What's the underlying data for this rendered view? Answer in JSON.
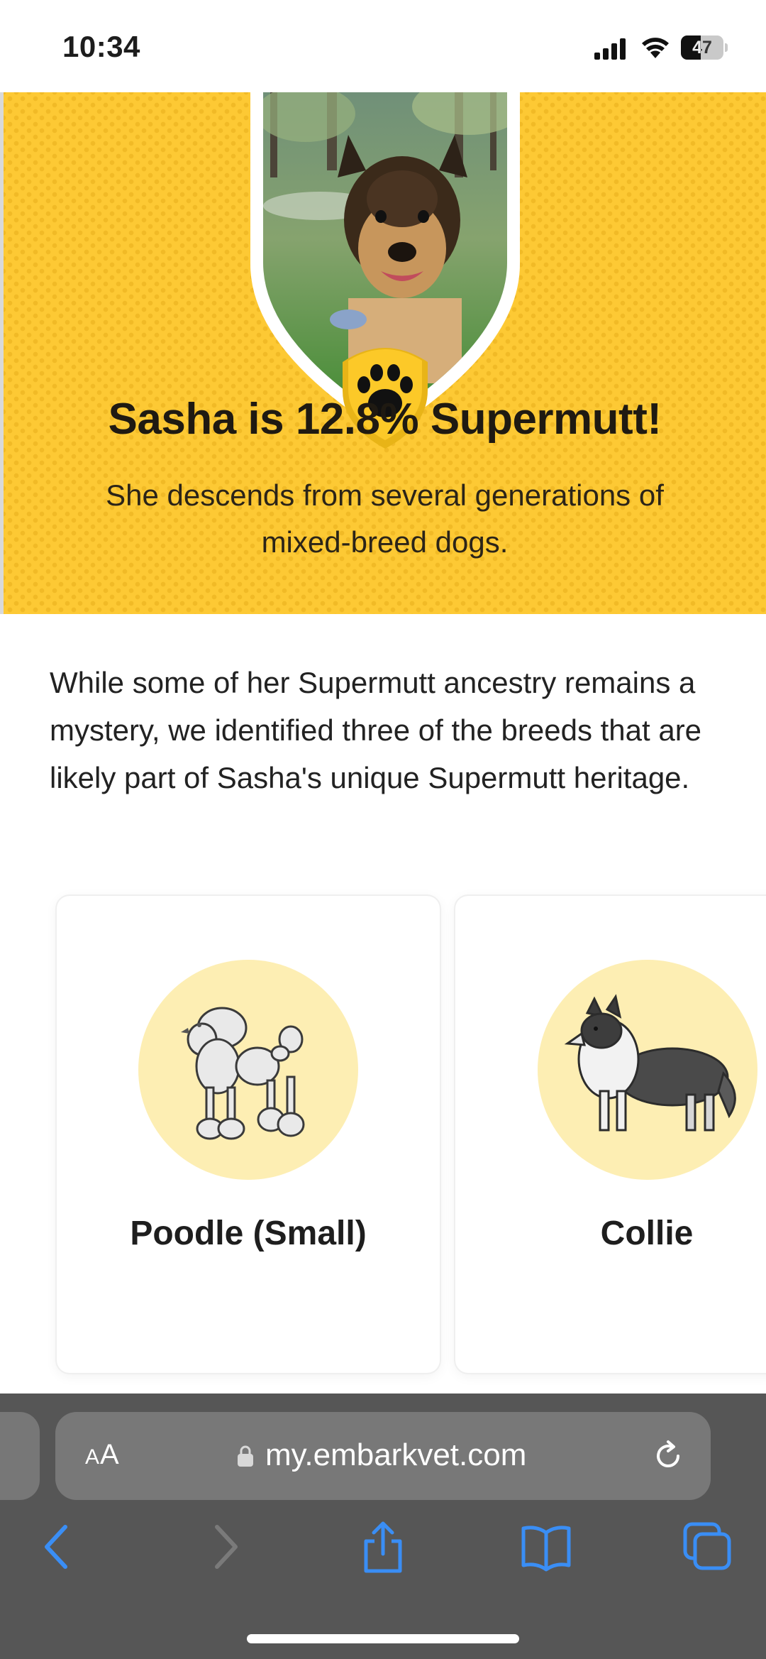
{
  "status_bar": {
    "time": "10:34",
    "battery": "47",
    "battery_level": 0.47
  },
  "hero": {
    "title": "Sasha is 12.8% Supermutt!",
    "subtitle": "She descends from several generations of mixed-breed dogs.",
    "background_color": "#fdc934",
    "badge_icon": "paw-icon"
  },
  "intro": {
    "text": "While some of her Supermutt ancestry remains a mystery, we identified three of the breeds that are likely part of Sasha's unique Supermutt heritage."
  },
  "breeds": [
    {
      "name": "Poodle (Small)",
      "icon": "poodle-illustration"
    },
    {
      "name": "Collie",
      "icon": "collie-illustration"
    }
  ],
  "browser": {
    "text_size_label_big": "A",
    "text_size_label_small": "A",
    "url": "my.embarkvet.com",
    "accent_color": "#3a8ef5"
  }
}
